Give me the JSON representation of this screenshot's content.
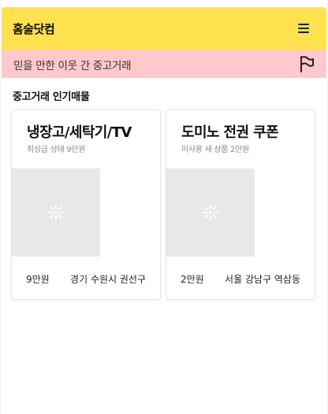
{
  "header": {
    "logo": "홈술닷컴",
    "menu_icon": "hamburger-menu-icon"
  },
  "banner": {
    "text": "믿을 만한 이웃 간 중고거래",
    "icon": "flag-icon",
    "color": "#ffc9cb"
  },
  "section": {
    "title": "중고거래 인기매물"
  },
  "listings": [
    {
      "title": "냉장고/세탁기/TV",
      "subtitle": "최상급 상태 9만원",
      "price": "9만원",
      "location": "경기 수원시 권선구"
    },
    {
      "title": "도미노 전권 쿠폰",
      "subtitle": "미사용 새 상품 2만원",
      "price": "2만원",
      "location": "서울 강남구 역삼동"
    }
  ],
  "colors": {
    "header_bg": "#ffe04f",
    "banner_bg": "#ffc9cb",
    "image_placeholder": "#e8e8e8"
  }
}
